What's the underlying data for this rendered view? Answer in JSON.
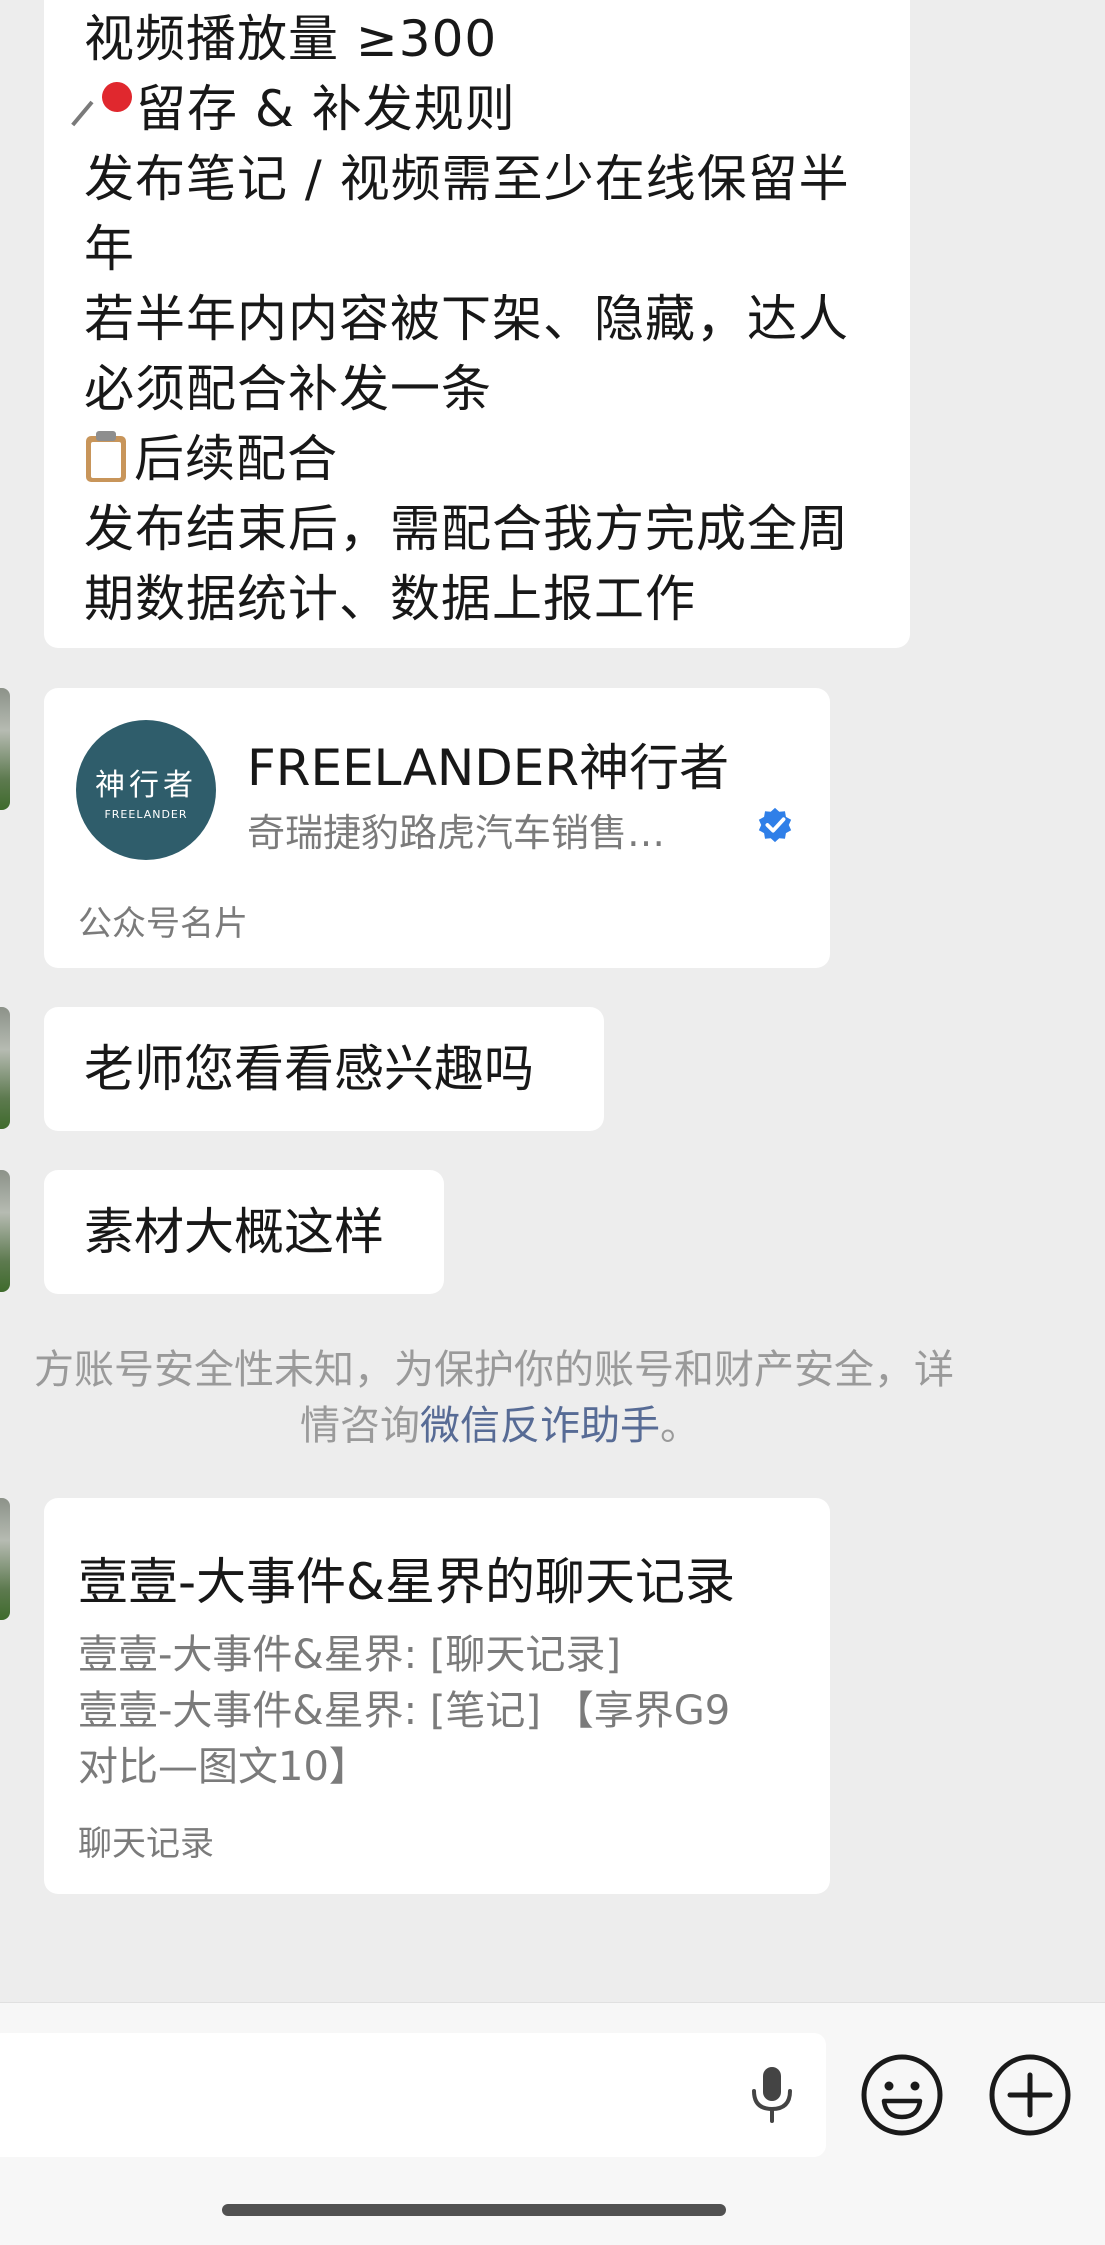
{
  "messages": {
    "rules": {
      "line1": "视频播放量 ≥300",
      "section1_emoji": "pin-icon",
      "section1_title": "留存 & 补发规则",
      "line3": "发布笔记 / 视频需至少在线保留半",
      "line4": "年",
      "line5": "若半年内内容被下架、隐藏，达人",
      "line6": "必须配合补发一条",
      "section2_emoji": "clipboard-icon",
      "section2_title": "后续配合",
      "line8": "发布结束后，需配合我方完成全周",
      "line9": "期数据统计、数据上报工作"
    },
    "account_card": {
      "logo_cn": "神行者",
      "logo_en": "FREELANDER",
      "name": "FREELANDER神行者",
      "subtitle": "奇瑞捷豹路虎汽车销售…",
      "card_type": "公众号名片",
      "accent_color": "#2f5d6b"
    },
    "teacher_msg": "老师您看看感兴趣吗",
    "material_msg": "素材大概这样",
    "warning": {
      "line1": "方账号安全性未知，为保护你的账号和财产安全，详",
      "line2_prefix": "情咨询",
      "link": "微信反诈助手",
      "line2_suffix": "。"
    },
    "chat_record": {
      "title": "壹壹-大事件&星界的聊天记录",
      "line1": "壹壹-大事件&星界: [聊天记录]",
      "line2": "壹壹-大事件&星界: [笔记] 【享界G9",
      "line3": "对比—图文10】",
      "footer": "聊天记录"
    }
  },
  "input_bar": {
    "text_value": "",
    "voice_icon": "microphone-icon",
    "emoji_icon": "smiley-icon",
    "more_icon": "plus-icon"
  }
}
